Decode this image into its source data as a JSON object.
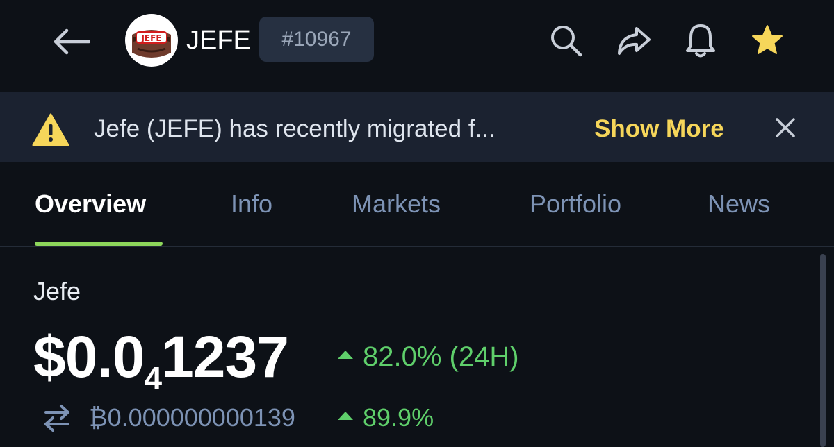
{
  "header": {
    "symbol": "JEFE",
    "rank": "#10967",
    "logo_text": "JEFE",
    "icons": [
      "back-arrow-icon",
      "search-icon",
      "share-icon",
      "bell-icon",
      "star-icon"
    ],
    "star_color": "#f6d65a"
  },
  "notice": {
    "text": "Jefe (JEFE) has recently migrated f...",
    "action_label": "Show More",
    "icon": "warning-icon",
    "close_icon": "close-icon"
  },
  "tabs": [
    {
      "label": "Overview",
      "active": true
    },
    {
      "label": "Info",
      "active": false
    },
    {
      "label": "Markets",
      "active": false
    },
    {
      "label": "Portfolio",
      "active": false
    },
    {
      "label": "News",
      "active": false
    }
  ],
  "coin": {
    "name": "Jefe",
    "price_prefix": "$0.0",
    "price_subscript": "4",
    "price_suffix": "1237",
    "change_24h": "82.0% (24H)",
    "btc_price": "₿0.000000000139",
    "btc_change": "89.9%"
  },
  "colors": {
    "background": "#0d1117",
    "banner": "#1b2230",
    "accent_green": "#5fcf6b",
    "tab_indicator": "#8dd65b",
    "show_more": "#f6d65a",
    "muted_text": "#7d93b5"
  }
}
